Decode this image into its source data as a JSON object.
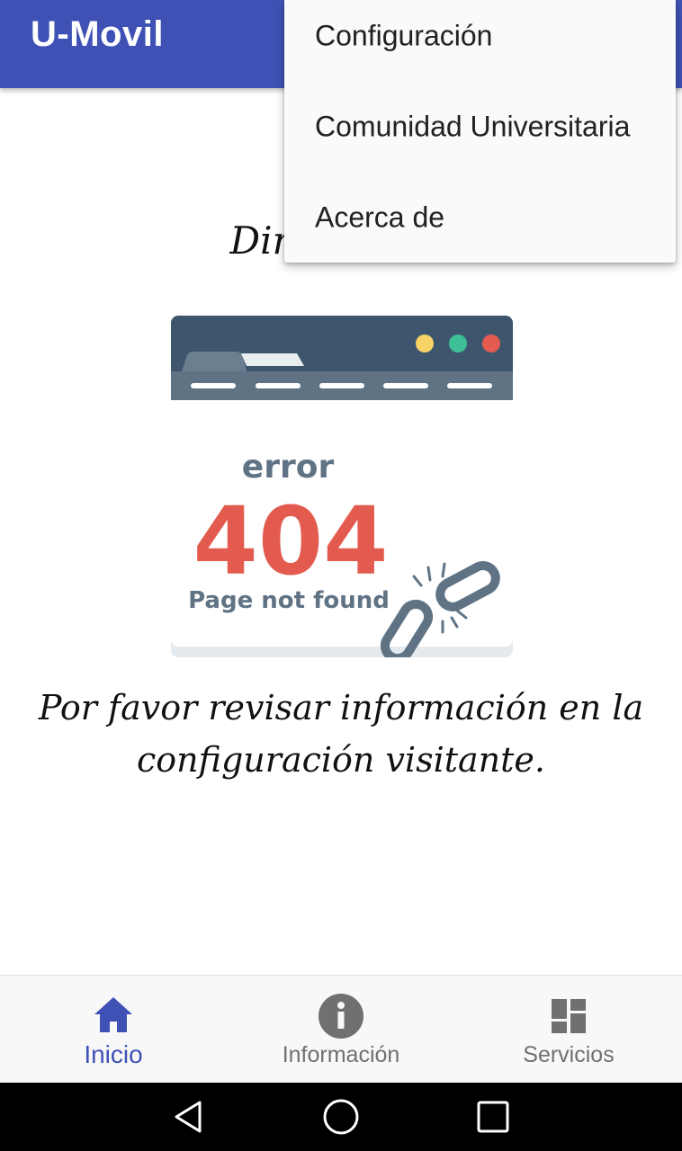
{
  "app_bar": {
    "title": "U-Movil"
  },
  "main": {
    "heading": "Dirección S",
    "error_image": {
      "word": "error",
      "code": "404",
      "caption": "Page not found",
      "icon": "broken-link-icon"
    },
    "message_line1": "Por favor revisar información en la",
    "message_line2": "configuración visitante."
  },
  "overflow_menu": {
    "items": [
      {
        "label": "Configuración"
      },
      {
        "label": "Comunidad Universitaria"
      },
      {
        "label": "Acerca de"
      }
    ]
  },
  "bottom_nav": {
    "items": [
      {
        "label": "Inicio",
        "icon": "home-icon",
        "active": true
      },
      {
        "label": "Información",
        "icon": "info-icon",
        "active": false
      },
      {
        "label": "Servicios",
        "icon": "dashboard-icon",
        "active": false
      }
    ]
  },
  "system_nav": {
    "buttons": [
      "back-icon",
      "home-circle-icon",
      "recents-icon"
    ]
  },
  "colors": {
    "primary": "#3f51b5",
    "error_red": "#e35b4f",
    "slate": "#5f7385",
    "inactive": "#707070"
  }
}
